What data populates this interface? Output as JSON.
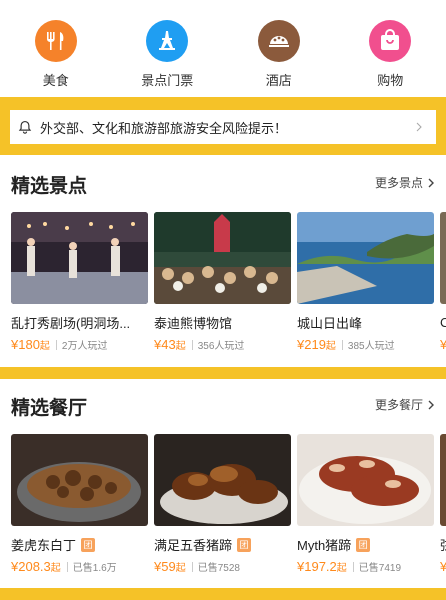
{
  "categories": [
    {
      "label": "美食",
      "icon": "fork-knife-icon",
      "color": "#f5822a"
    },
    {
      "label": "景点门票",
      "icon": "tower-icon",
      "color": "#1f9ef2"
    },
    {
      "label": "酒店",
      "icon": "hotel-bed-icon",
      "color": "#8b5a3c"
    },
    {
      "label": "购物",
      "icon": "shopping-bag-icon",
      "color": "#f14f8e"
    }
  ],
  "notice": {
    "text": "外交部、文化和旅游部旅游安全风险提示！",
    "icon": "bell-icon"
  },
  "attractions": {
    "title": "精选景点",
    "more": "更多景点",
    "items": [
      {
        "name": "乱打秀剧场(明洞场...",
        "price": "¥180",
        "unit": "起",
        "stat": "2万人玩过"
      },
      {
        "name": "泰迪熊博物馆",
        "price": "¥43",
        "unit": "起",
        "stat": "356人玩过"
      },
      {
        "name": "城山日出峰",
        "price": "¥219",
        "unit": "起",
        "stat": "385人玩过"
      },
      {
        "name": "C",
        "price": "¥",
        "unit": "",
        "stat": ""
      }
    ]
  },
  "restaurants": {
    "title": "精选餐厅",
    "more": "更多餐厅",
    "tag": "团",
    "items": [
      {
        "name": "姜虎东白丁",
        "price": "¥208.3",
        "unit": "起",
        "stat": "已售1.6万"
      },
      {
        "name": "满足五香猪蹄",
        "price": "¥59",
        "unit": "起",
        "stat": "已售7528"
      },
      {
        "name": "Myth猪蹄",
        "price": "¥197.2",
        "unit": "起",
        "stat": "已售7419"
      },
      {
        "name": "弦",
        "price": "¥",
        "unit": "",
        "stat": ""
      }
    ]
  },
  "colors": {
    "accent": "#ff8a1c",
    "band": "#f5c228"
  }
}
